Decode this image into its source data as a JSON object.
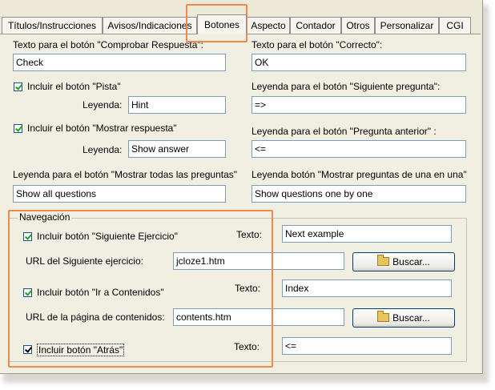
{
  "tabs": [
    {
      "label": "Títulos/Instrucciones",
      "active": false
    },
    {
      "label": "Avisos/Indicaciones",
      "active": false
    },
    {
      "label": "Botones",
      "active": true
    },
    {
      "label": "Aspecto",
      "active": false
    },
    {
      "label": "Contador",
      "active": false
    },
    {
      "label": "Otros",
      "active": false
    },
    {
      "label": "Personalizar",
      "active": false
    },
    {
      "label": "CGI",
      "active": false
    }
  ],
  "left": {
    "check_label": "Texto para el botón \"Comprobar Respuesta\":",
    "check_value": "Check",
    "hint_checkbox": "Incluir el botón \"Pista\"",
    "hint_caption": "Leyenda:",
    "hint_value": "Hint",
    "show_answer_checkbox": "Incluir el botón \"Mostrar respuesta\"",
    "show_answer_caption": "Leyenda:",
    "show_answer_value": "Show answer",
    "show_all_label": "Leyenda para el botón \"Mostrar todas las preguntas\"",
    "show_all_value": "Show all questions"
  },
  "right": {
    "correct_label": "Texto para el botón \"Correcto\":",
    "correct_value": "OK",
    "next_q_label": "Leyenda para el botón \"Siguiente pregunta\":",
    "next_q_value": "=>",
    "prev_q_label": "Leyenda para el botón \"Pregunta anterior\" :",
    "prev_q_value": "<=",
    "one_by_one_label": "Leyenda botón \"Mostrar preguntas de una en una\"",
    "one_by_one_value": "Show questions one by one"
  },
  "nav": {
    "legend": "Navegación",
    "next_ex_checkbox": "Incluir botón \"Siguiente Ejercicio\"",
    "next_ex_text_caption": "Texto:",
    "next_ex_text_value": "Next example",
    "next_ex_url_label": "URL del Siguiente ejercicio:",
    "next_ex_url_value": "jcloze1.htm",
    "browse_label_1": "Buscar...",
    "contents_checkbox": "Incluir botón \"Ir a Contenidos\"",
    "contents_text_caption": "Texto:",
    "contents_text_value": "Index",
    "contents_url_label": "URL de la página de contenidos:",
    "contents_url_value": "contents.htm",
    "browse_label_2": "Buscar...",
    "back_checkbox": "Incluir botón \"Atrás\"",
    "back_text_caption": "Texto:",
    "back_text_value": "<="
  },
  "colors": {
    "highlight": "#f08a4b",
    "panel": "#f1efe2",
    "input_border": "#7f9db9"
  },
  "icons": {
    "browse": "folder-icon"
  }
}
